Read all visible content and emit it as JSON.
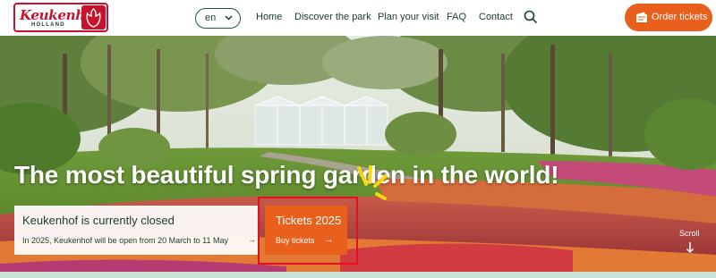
{
  "header": {
    "logo": {
      "brand": "Keukenhof",
      "sub": "HOLLAND"
    },
    "language": "en",
    "nav": [
      "Home",
      "Discover the park",
      "Plan your visit",
      "FAQ",
      "Contact"
    ],
    "order_button": "Order tickets"
  },
  "hero": {
    "title": "The most beautiful spring garden in the world!",
    "closed_card": {
      "title": "Keukenhof is currently closed",
      "subtitle": "In 2025, Keukenhof will be open from 20 March to 11 May",
      "arrow": "→"
    },
    "tickets_card": {
      "title": "Tickets 2025",
      "link": "Buy tickets",
      "arrow": "→"
    },
    "scroll_label": "Scroll"
  },
  "icons": {
    "search": "search-icon",
    "chevron": "chevron-down-icon",
    "ticket": "ticket-icon",
    "scroll_arrow": "arrow-down-icon"
  },
  "colors": {
    "brand_red": "#c6122d",
    "accent_orange": "#e8601c",
    "dark_green": "#1d3a2c",
    "highlight_red": "#e0121f"
  }
}
